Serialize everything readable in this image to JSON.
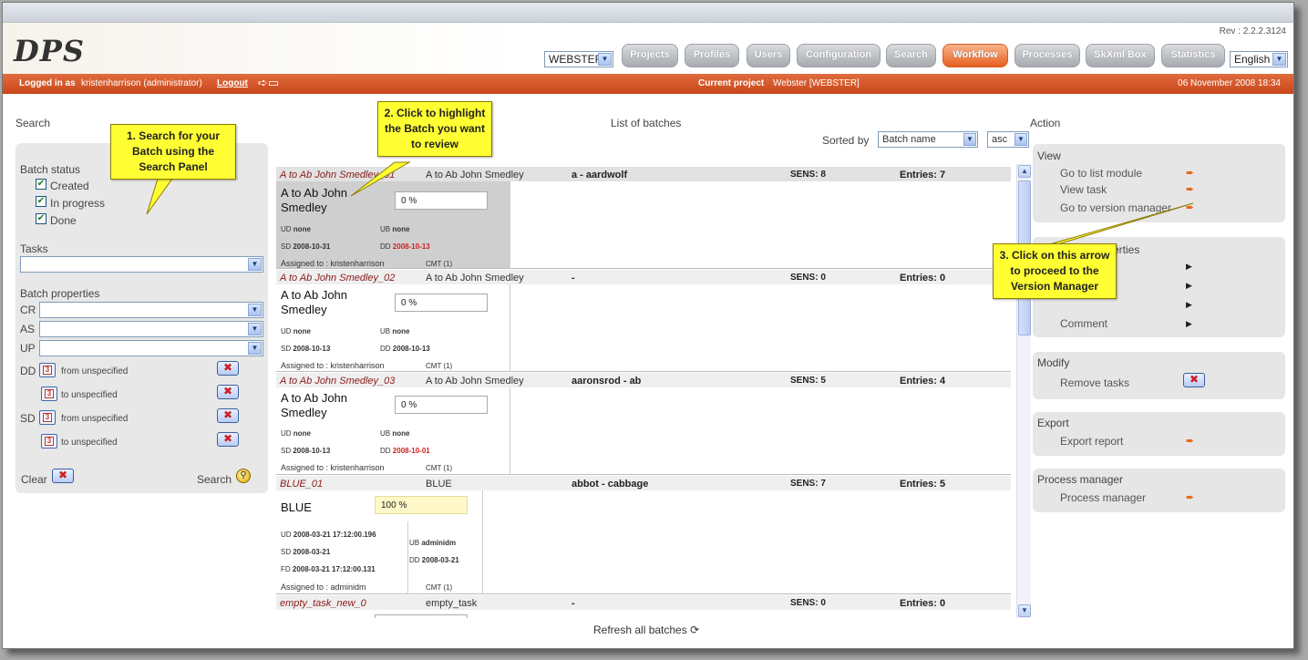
{
  "header": {
    "logo": "DPS",
    "rev": "Rev : 2.2.2.3124",
    "project_select": "WEBSTER",
    "nav": [
      "Projects",
      "Profiles",
      "Users",
      "Configuration",
      "Search",
      "Workflow",
      "Processes",
      "SkXml Box",
      "Statistics"
    ],
    "active_nav": "Workflow",
    "language": "English"
  },
  "loginbar": {
    "logged_in_prefix": "Logged in as",
    "user": "kristenharrison (administrator)",
    "logout": "Logout",
    "current_project_label": "Current project",
    "current_project": "Webster [WEBSTER]",
    "datetime": "06 November 2008 18:34"
  },
  "search": {
    "title": "Search",
    "batch_status_label": "Batch status",
    "statuses": [
      "Created",
      "In progress",
      "Done"
    ],
    "tasks_label": "Tasks",
    "batch_props_label": "Batch properties",
    "props": [
      "CR",
      "AS",
      "UP"
    ],
    "dd_label": "DD",
    "sd_label": "SD",
    "cal_number": "3",
    "from_unspecified": "from unspecified",
    "to_unspecified": "to unspecified",
    "clear": "Clear",
    "search_btn": "Search"
  },
  "list": {
    "title": "List of batches",
    "sorted_by_label": "Sorted by",
    "sort_field": "Batch name",
    "sort_order": "asc",
    "refresh": "Refresh all batches",
    "batches": [
      {
        "name": "A to Ab John Smedley_01",
        "short": "A to Ab John Smedley",
        "range": "a - aardwolf",
        "sens": "SENS: 8",
        "entries": "Entries: 7",
        "big1": "A to Ab John",
        "big2": "Smedley",
        "pct": "0 %",
        "ud": "none",
        "ub": "none",
        "sd": "2008-10-31",
        "dd": "2008-10-13",
        "assigned": "Assigned to : kristenharrison",
        "cmt": "CMT (1)"
      },
      {
        "name": "A to Ab John Smedley_02",
        "short": "A to Ab John Smedley",
        "range": "-",
        "sens": "SENS: 0",
        "entries": "Entries: 0",
        "big1": "A to Ab John",
        "big2": "Smedley",
        "pct": "0 %",
        "ud": "none",
        "ub": "none",
        "sd": "2008-10-13",
        "dd": "2008-10-13",
        "assigned": "Assigned to : kristenharrison",
        "cmt": "CMT (1)"
      },
      {
        "name": "A to Ab John Smedley_03",
        "short": "A to Ab John Smedley",
        "range": "aaronsrod - ab",
        "sens": "SENS: 5",
        "entries": "Entries: 4",
        "big1": "A to Ab John",
        "big2": "Smedley",
        "pct": "0 %",
        "ud": "none",
        "ub": "none",
        "sd": "2008-10-13",
        "dd": "2008-10-01",
        "assigned": "Assigned to : kristenharrison",
        "cmt": "CMT (1)"
      },
      {
        "name": "BLUE_01",
        "short": "BLUE",
        "range": "abbot - cabbage",
        "sens": "SENS: 7",
        "entries": "Entries: 5",
        "big1": "BLUE",
        "pct": "100 %",
        "ud": "2008-03-21 17:12:00.196",
        "ub": "adminidm",
        "sd": "2008-03-21",
        "dd": "2008-03-21",
        "fd": "2008-03-21 17:12:00.131",
        "assigned": "Assigned to : adminidm",
        "cmt": "CMT (1)"
      },
      {
        "name": "empty_task_new_0",
        "short": "empty_task",
        "range": "-",
        "sens": "SENS: 0",
        "entries": "Entries: 0"
      }
    ],
    "meta_labels": {
      "ud": "UD",
      "ub": "UB",
      "sd": "SD",
      "dd": "DD",
      "fd": "FD"
    }
  },
  "action": {
    "title": "Action",
    "view_title": "View",
    "view_items": [
      "Go to list module",
      "View task",
      "Go to version manager"
    ],
    "props_title_partial": "erties",
    "props_item": "Comment",
    "modify_title": "Modify",
    "modify_item": "Remove tasks",
    "export_title": "Export",
    "export_item": "Export report",
    "pm_title": "Process manager",
    "pm_item": "Process manager"
  },
  "callouts": {
    "c1": "1. Search for your Batch using the Search Panel",
    "c2": "2. Click to highlight the Batch you want to review",
    "c3": "3. Click on this arrow to proceed to the Version Manager"
  }
}
